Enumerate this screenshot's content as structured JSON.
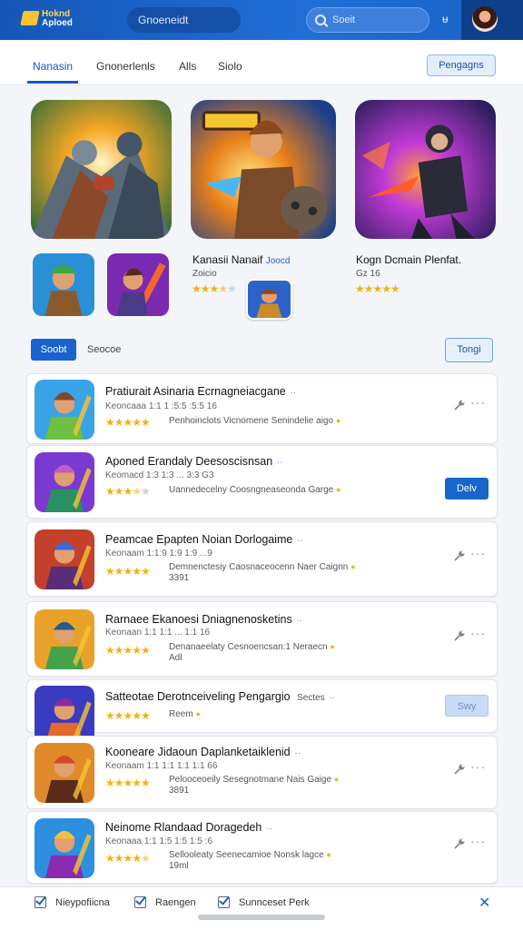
{
  "header": {
    "logo_line1": "Hoknd",
    "logo_line2": "Aploed",
    "app_title": "Gnoeneidt",
    "search_placeholder": "Soeit",
    "filter_label": "ᵾ"
  },
  "tabs": [
    {
      "label": "Nanasin",
      "active": true
    },
    {
      "label": "Gnonerlenls",
      "active": false
    },
    {
      "label": "Alls",
      "active": false
    },
    {
      "label": "Siolo",
      "active": false
    }
  ],
  "paggbtn_label": "Pengagns",
  "featured": [
    {
      "title": "",
      "colors": [
        "#f5a623",
        "#3a2b20",
        "#6a7a88"
      ]
    },
    {
      "title": "Kanasii Nanaif",
      "title_suffix": "Joocd",
      "sub": "Zoicio",
      "stars": 3.5,
      "colors": [
        "#f4a31c",
        "#2d63c8",
        "#7a4a2a"
      ]
    },
    {
      "title": "Kogn Dcmain Plenfat.",
      "sub": "Gz 16",
      "stars": 5,
      "colors": [
        "#b33ad8",
        "#2a1e5c",
        "#f2662f"
      ]
    }
  ],
  "segment": {
    "active_label": "Soobt",
    "label": "Seocoe",
    "action_label": "Tongi"
  },
  "rows": [
    {
      "title": "Pratiurait Asinaria Ecrnagneiacgane",
      "meta": "Keoncaaa 1:1 1 :5:5 :5:5 16",
      "stars": 5,
      "desc": "Penhoinclots Vicnomene Senindelie aigo",
      "extra": "",
      "button": ""
    },
    {
      "title": "Aponed Erandaly Deesoscisnsan",
      "meta": "Keomacd 1:3 1:3 ... 3:3 G3",
      "stars": 3.5,
      "desc": "Uannedecelny Coosngneaseonda Garge",
      "extra": "",
      "button": "Delv"
    },
    {
      "title": "Peamcae Epapten Noian Dorlogaime",
      "meta": "Keonaam 1:1:9 1:9 1:9 ...9",
      "stars": 5,
      "desc": "Demnenctesiy Caosnaceocenn Naer Caignn",
      "extra": "3391",
      "button": ""
    },
    {
      "title": "Rarnaee Ekanoesi Dniagnenosketins",
      "meta": "Keonaan 1:1 1:1 ... 1:1 16",
      "stars": 5,
      "desc": "Denanaeelaty Cesnoencsan:1 Neraecn",
      "extra": "Adl",
      "button": ""
    },
    {
      "title": "Satteotae Derotnceiveling Pengargio",
      "title_suffix": "Sectes",
      "meta": "",
      "stars": 5,
      "desc": "Reem",
      "extra": "",
      "button": "Swy"
    },
    {
      "title": "Kooneare Jidaoun Daplanketaiklenid",
      "meta": "Keonaam 1:1 1:1 1:1 1:1 66",
      "stars": 5,
      "desc": "Pelooceoeily Sesegnotmane Nais Gaige",
      "extra": "3891",
      "button": ""
    },
    {
      "title": "Neinome Rlandaad Doragedeh",
      "meta": "Keonaaa 1:1 1:5 1:5 1:5 :6",
      "stars": 4.5,
      "desc": "Sellooleaty Seenecamioe Nonsk lagce",
      "extra": "19ml",
      "button": ""
    }
  ],
  "row_art": [
    [
      "#3aa3e8",
      "#6fbf40",
      "#7a4b2a"
    ],
    [
      "#7a3ad1",
      "#2a8f62",
      "#c25ec2"
    ],
    [
      "#c2402c",
      "#5a2c78",
      "#3d6ad3"
    ],
    [
      "#e8a22a",
      "#46a24a",
      "#2a5a8a"
    ],
    [
      "#3a3cbf",
      "#e06b2a",
      "#8a2ca0"
    ],
    [
      "#e08a2a",
      "#5a2a1a",
      "#d24a2a"
    ],
    [
      "#2c8fe0",
      "#8a2ab0",
      "#f0c040"
    ]
  ],
  "bottom": [
    {
      "label": "Nieypofiicna"
    },
    {
      "label": "Raengen"
    },
    {
      "label": "Sunnceset  Perk"
    }
  ]
}
